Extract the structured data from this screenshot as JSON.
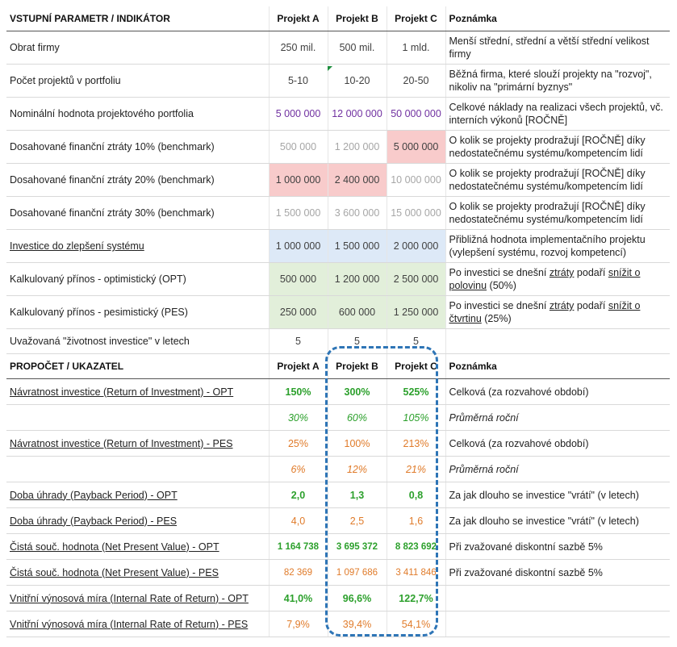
{
  "input_header": {
    "label": "VSTUPNÍ PARAMETR / INDIKÁTOR",
    "a": "Projekt A",
    "b": "Projekt B",
    "c": "Projekt C",
    "note": "Poznámka"
  },
  "inputs": [
    {
      "label": "Obrat firmy",
      "a": "250 mil.",
      "b": "500 mil.",
      "c": "1 mld.",
      "note": "Menší střední, střední a větší střední velikost firmy"
    },
    {
      "label": "Počet projektů v portfoliu",
      "a": "5-10",
      "b": "10-20",
      "c": "20-50",
      "note": "Běžná firma, které slouží projekty na \"rozvoj\", nikoliv na \"primární byznys\""
    },
    {
      "label": "Nominální hodnota projektového portfolia",
      "a": "5 000 000",
      "b": "12 000 000",
      "c": "50 000 000",
      "note": "Celkové náklady na realizaci všech projektů, vč. interních výkonů [ROČNĚ]"
    },
    {
      "label": "Dosahované finanční ztráty 10% (benchmark)",
      "a": "500 000",
      "b": "1 200 000",
      "c": "5 000 000",
      "note": "O kolik se projekty prodražují [ROČNĚ] díky nedostatečnému systému/kompetencím lidí"
    },
    {
      "label": "Dosahované finanční ztráty 20% (benchmark)",
      "a": "1 000 000",
      "b": "2 400 000",
      "c": "10 000 000",
      "note": "O kolik se projekty prodražují [ROČNĚ] díky nedostatečnému systému/kompetencím lidí"
    },
    {
      "label": "Dosahované finanční ztráty 30% (benchmark)",
      "a": "1 500 000",
      "b": "3 600 000",
      "c": "15 000 000",
      "note": "O kolik se projekty prodražují [ROČNĚ] díky nedostatečnému systému/kompetencím lidí"
    },
    {
      "label": "Investice do zlepšení systému",
      "a": "1 000 000",
      "b": "1 500 000",
      "c": "2 000 000",
      "note": "Přibližná hodnota implementačního projektu (vylepšení systému, rozvoj kompetencí)"
    },
    {
      "label": "Kalkulovaný přínos - optimistický (OPT)",
      "a": "500 000",
      "b": "1 200 000",
      "c": "2 500 000",
      "note_pre": "Po investici se dnešní ",
      "note_u1": "ztráty",
      "note_mid": " podaří ",
      "note_u2": "snížit o polovinu",
      "note_post": " (50%)"
    },
    {
      "label": "Kalkulovaný přínos - pesimistický (PES)",
      "a": "250 000",
      "b": "600 000",
      "c": "1 250 000",
      "note_pre": "Po investici se dnešní ",
      "note_u1": "ztráty",
      "note_mid": " podaří ",
      "note_u2": "snížit o čtvrtinu",
      "note_post": " (25%)"
    },
    {
      "label": "Uvažovaná \"životnost investice\" v letech",
      "a": "5",
      "b": "5",
      "c": "5",
      "note": ""
    }
  ],
  "calc_header": {
    "label": "PROPOČET / UKAZATEL",
    "a": "Projekt A",
    "b": "Projekt B",
    "c": "Projekt C",
    "note": "Poznámka"
  },
  "calc": [
    {
      "label": "Návratnost investice (Return of Investment) - OPT",
      "a": "150%",
      "b": "300%",
      "c": "525%",
      "note": "Celková (za rozvahové období)"
    },
    {
      "label": "",
      "a": "30%",
      "b": "60%",
      "c": "105%",
      "note": "Průměrná roční"
    },
    {
      "label": "Návratnost investice (Return of Investment) - PES",
      "a": "25%",
      "b": "100%",
      "c": "213%",
      "note": "Celková (za rozvahové období)"
    },
    {
      "label": "",
      "a": "6%",
      "b": "12%",
      "c": "21%",
      "note": "Průměrná roční"
    },
    {
      "label": "Doba úhrady (Payback Period) - OPT",
      "a": "2,0",
      "b": "1,3",
      "c": "0,8",
      "note": "Za jak dlouho se investice \"vrátí\" (v letech)"
    },
    {
      "label": "Doba úhrady (Payback Period) - PES",
      "a": "4,0",
      "b": "2,5",
      "c": "1,6",
      "note": "Za jak dlouho se investice \"vrátí\" (v letech)"
    },
    {
      "label": "Čistá souč. hodnota (Net Present Value) - OPT",
      "a": "1 164 738",
      "b": "3 695 372",
      "c": "8 823 692",
      "note": "Při zvažované diskontní sazbě 5%"
    },
    {
      "label": "Čistá souč. hodnota (Net Present Value) - PES",
      "a": "82 369",
      "b": "1 097 686",
      "c": "3 411 846",
      "note": "Při zvažované diskontní sazbě 5%"
    },
    {
      "label": "Vnitřní výnosová míra (Internal Rate of Return) - OPT",
      "a": "41,0%",
      "b": "96,6%",
      "c": "122,7%",
      "note": ""
    },
    {
      "label": "Vnitřní výnosová míra (Internal Rate of Return) - PES",
      "a": "7,9%",
      "b": "39,4%",
      "c": "54,1%",
      "note": ""
    }
  ],
  "colors": {
    "highlight_border": "#2e75b6",
    "opt_green": "#2ca02c",
    "pes_orange": "#e07b2a",
    "red_cell": "#f8cbcb",
    "blue_cell": "#dde9f7",
    "green_cell": "#e2efda"
  }
}
